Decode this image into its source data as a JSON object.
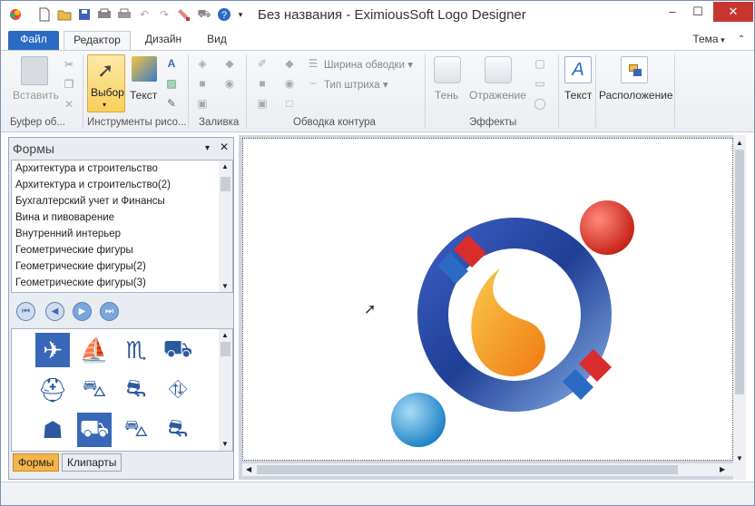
{
  "app": {
    "title": "Без названия - EximiousSoft Logo Designer"
  },
  "window": {
    "minimize": "‒",
    "maximize": "☐",
    "close": "✕"
  },
  "quick_access": {
    "icons": [
      "app-logo-icon",
      "new-icon",
      "open-icon",
      "save-icon",
      "print-preview-icon",
      "print-icon",
      "undo-icon",
      "redo-icon",
      "paint-icon",
      "cart-icon",
      "help-icon"
    ]
  },
  "tabs": [
    {
      "label": "Файл"
    },
    {
      "label": "Редактор"
    },
    {
      "label": "Дизайн"
    },
    {
      "label": "Вид"
    }
  ],
  "theme_label": "Тема",
  "ribbon": {
    "paste": "Вставить",
    "select": "Выбор",
    "text_tool": "Текст",
    "stroke_width": "Ширина обводки",
    "stroke_type": "Тип штриха",
    "shadow": "Тень",
    "reflection": "Отражение",
    "text": "Текст",
    "arrange": "Расположение",
    "groups": {
      "clipboard": "Буфер об...",
      "drawing_tools": "Инструменты рисо...",
      "fill": "Заливка",
      "stroke": "Обводка контура",
      "effects": "Эффекты"
    }
  },
  "panel": {
    "title": "Формы",
    "categories": [
      "Архитектура и строительство",
      "Архитектура и строительство(2)",
      "Бухгалтерский учет и  Финансы",
      "Вина и пивоварение",
      "Внутренний интерьер",
      "Геометрические фигуры",
      "Геометрические фигуры(2)",
      "Геометрические фигуры(3)"
    ],
    "tabs": [
      "Формы",
      "Клипарты"
    ]
  },
  "colors": {
    "accent": "#2b6bc4",
    "ring": "#1f3f95",
    "flame_orange": "#f28a1c",
    "red_ball": "#d42a20",
    "blue_ball": "#2a8fd0"
  }
}
